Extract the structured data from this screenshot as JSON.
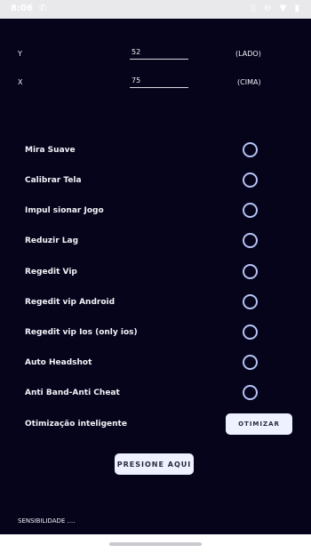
{
  "status_bar": {
    "time": "8:06",
    "phone_icon": "phone-icon",
    "icons": [
      "vibrate-icon",
      "dnd-icon",
      "wifi-icon",
      "battery-icon"
    ]
  },
  "coords": {
    "y": {
      "label": "Y",
      "value": "52",
      "side": "(LADO)"
    },
    "x": {
      "label": "X",
      "value": "75",
      "side": "(CIMA)"
    }
  },
  "options": [
    {
      "label": "Mira Suave"
    },
    {
      "label": "Calibrar Tela"
    },
    {
      "label": "Impul sionar Jogo"
    },
    {
      "label": "Reduzir Lag"
    },
    {
      "label": "Regedit Vip"
    },
    {
      "label": "Regedit vip Android"
    },
    {
      "label": "Regedit vip Ios (only ios)"
    },
    {
      "label": "Auto Headshot"
    },
    {
      "label": "Anti Band-Anti Cheat"
    }
  ],
  "optimize": {
    "label": "Otimização inteligente",
    "button": "OTIMIZAR"
  },
  "press_button": "PRESIONE AQUI",
  "sensitivity_label": "SENSIBILIDADE ....",
  "colors": {
    "background": "#05041b",
    "accent": "#b6c2f2",
    "button_bg": "#eef1ff"
  }
}
